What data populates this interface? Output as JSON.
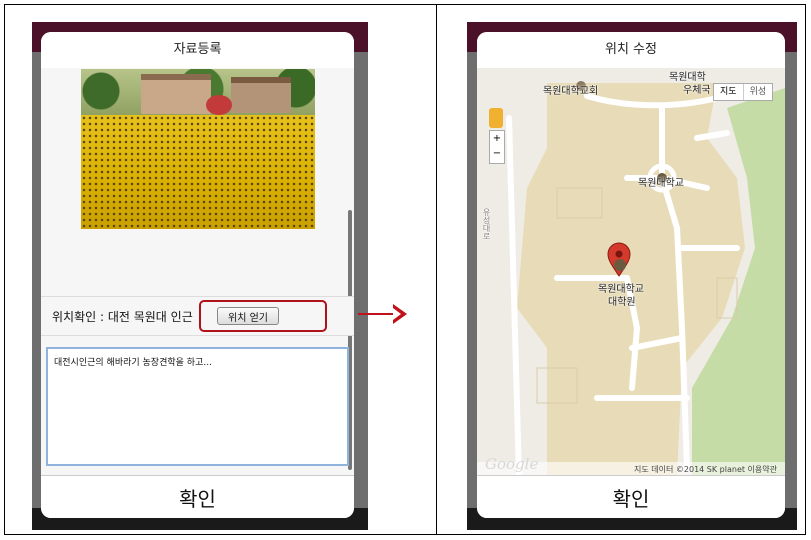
{
  "left": {
    "title": "자료등록",
    "location_label": "위치확인 : 대전 목원대 인근",
    "location_button": "위치 얻기",
    "memo_text": "대전시인근의 해바라기 농장견학을 하고...",
    "confirm": "확인"
  },
  "right": {
    "title": "위치 수정",
    "maptype_map": "지도",
    "maptype_satellite": "위성",
    "zoom_in": "+",
    "zoom_out": "−",
    "labels": {
      "church": "목원대학교회",
      "post1": "목원대학",
      "post2": "우체국",
      "campus": "목원대학교",
      "grad1": "목원대학교",
      "grad2": "대학원",
      "road": "유성대로"
    },
    "google": "Google",
    "attribution": "지도 데이터 ©2014 SK planet   이용약관",
    "confirm": "확인"
  },
  "colors": {
    "campus": "#e8dcb8",
    "park": "#c6dca6",
    "accent_red": "#c1121b",
    "pin": "#d33a2c"
  }
}
